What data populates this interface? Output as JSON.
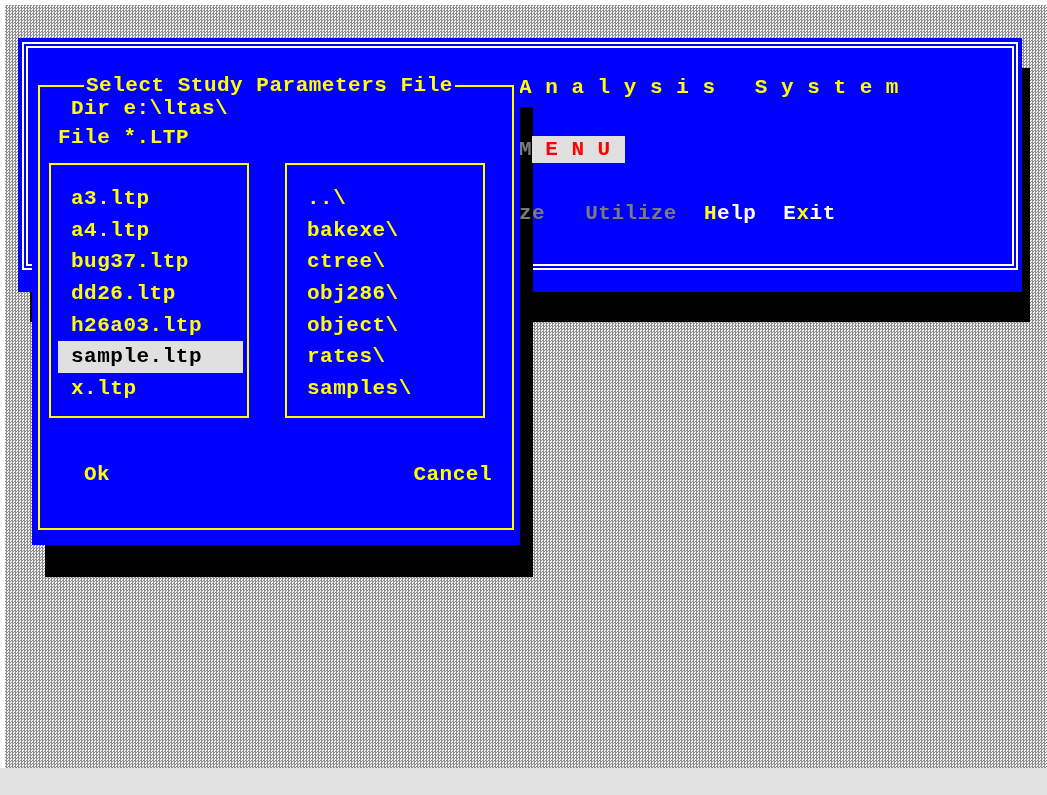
{
  "main_window": {
    "title": "A n a l y s i s   S y s t e m",
    "menu_title": "M E N U",
    "menu_items": [
      {
        "text": "ze",
        "disabled": true
      },
      {
        "text": "Utilize",
        "disabled": true
      },
      {
        "hotkey": "H",
        "suffix": "elp",
        "disabled": false
      },
      {
        "prefix": "E",
        "hotkey": "x",
        "suffix": "it",
        "disabled": false
      }
    ]
  },
  "dialog": {
    "title": "Select Study Parameters File",
    "dir_line": "Dir e:\\ltas\\",
    "file_line": "File *.LTP",
    "files": [
      {
        "name": "a3.ltp",
        "selected": false
      },
      {
        "name": "a4.ltp",
        "selected": false
      },
      {
        "name": "bug37.ltp",
        "selected": false
      },
      {
        "name": "dd26.ltp",
        "selected": false
      },
      {
        "name": "h26a03.ltp",
        "selected": false
      },
      {
        "name": "sample.ltp",
        "selected": true
      },
      {
        "name": "x.ltp",
        "selected": false
      }
    ],
    "directories": [
      "..\\",
      "bakexe\\",
      "ctree\\",
      "obj286\\",
      "object\\",
      "rates\\",
      "samples\\"
    ],
    "buttons": [
      "Ok",
      "Cancel"
    ]
  }
}
